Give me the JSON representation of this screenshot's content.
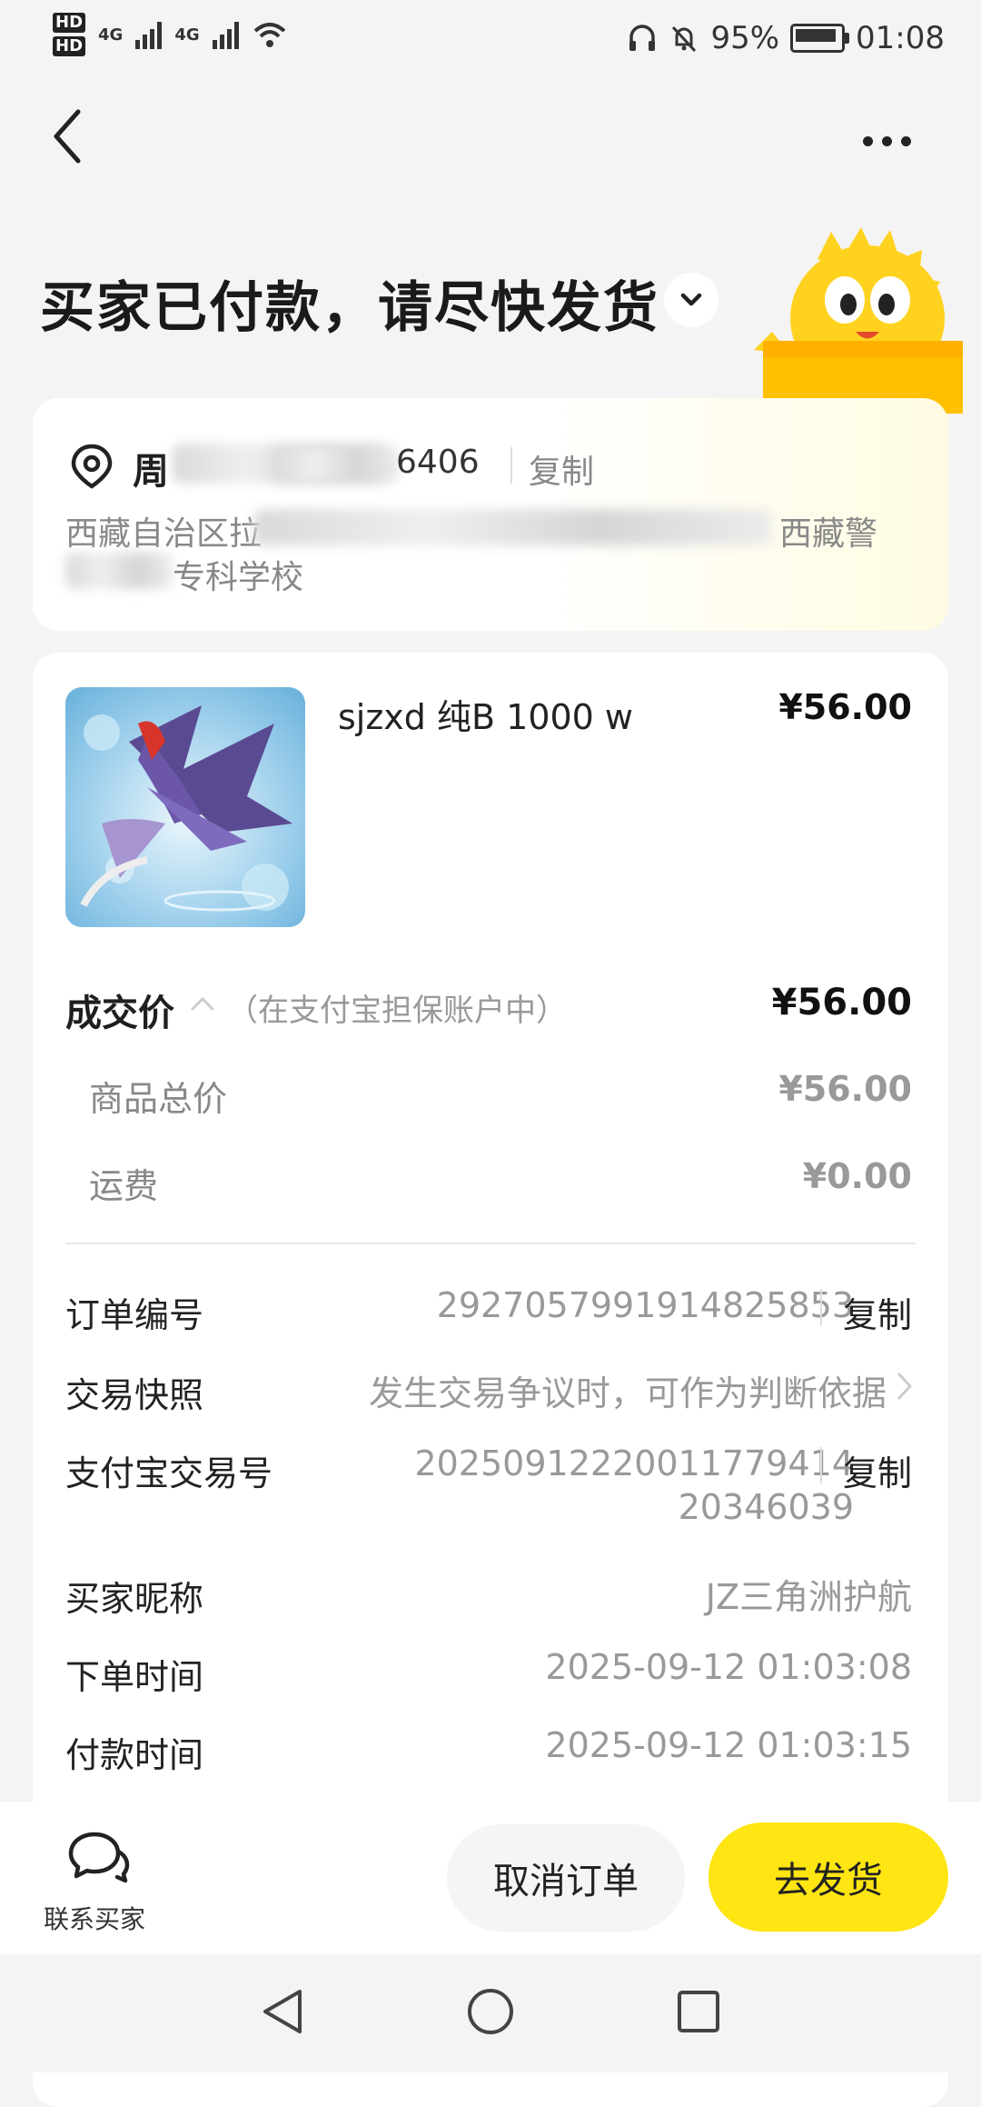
{
  "status_bar": {
    "hd1": "HD",
    "hd2": "HD",
    "net1": "4G",
    "net2": "4G",
    "battery_percent": "95%",
    "time": "01:08"
  },
  "header": {
    "title": "买家已付款，请尽快发货"
  },
  "address": {
    "name": "周",
    "phone_tail": "6406",
    "copy_label": "复制",
    "line1": "西藏自治区拉",
    "line1_tail": "西藏警",
    "line2_tail": "专科学校"
  },
  "product": {
    "title": "sjzxd 纯B 1000 w",
    "price": "¥56.00"
  },
  "pricing": {
    "deal_label": "成交价",
    "deal_note": "（在支付宝担保账户中）",
    "deal_price": "¥56.00",
    "goods_total_label": "商品总价",
    "goods_total_value": "¥56.00",
    "shipping_label": "运费",
    "shipping_value": "¥0.00"
  },
  "order_info": {
    "order_no_label": "订单编号",
    "order_no_value": "2927057991914825853",
    "copy_label": "复制",
    "snapshot_label": "交易快照",
    "snapshot_value": "发生交易争议时，可作为判断依据",
    "alipay_label": "支付宝交易号",
    "alipay_value_line1": "20250912220011779414",
    "alipay_value_line2": "20346039",
    "buyer_label": "买家昵称",
    "buyer_value": "JZ三角洲护航",
    "order_time_label": "下单时间",
    "order_time_value": "2025-09-12 01:03:08",
    "pay_time_label": "付款时间",
    "pay_time_value": "2025-09-12 01:03:15"
  },
  "actions": {
    "contact_label": "联系买家",
    "cancel_label": "取消订单",
    "ship_label": "去发货"
  },
  "colors": {
    "accent_yellow": "#ffe511",
    "page_bg": "#f4f4f4",
    "muted_text": "#999999"
  },
  "icons": {
    "back": "back-chevron-icon",
    "more": "more-dots-icon",
    "location": "location-pin-icon",
    "chat": "chat-bubble-icon"
  }
}
